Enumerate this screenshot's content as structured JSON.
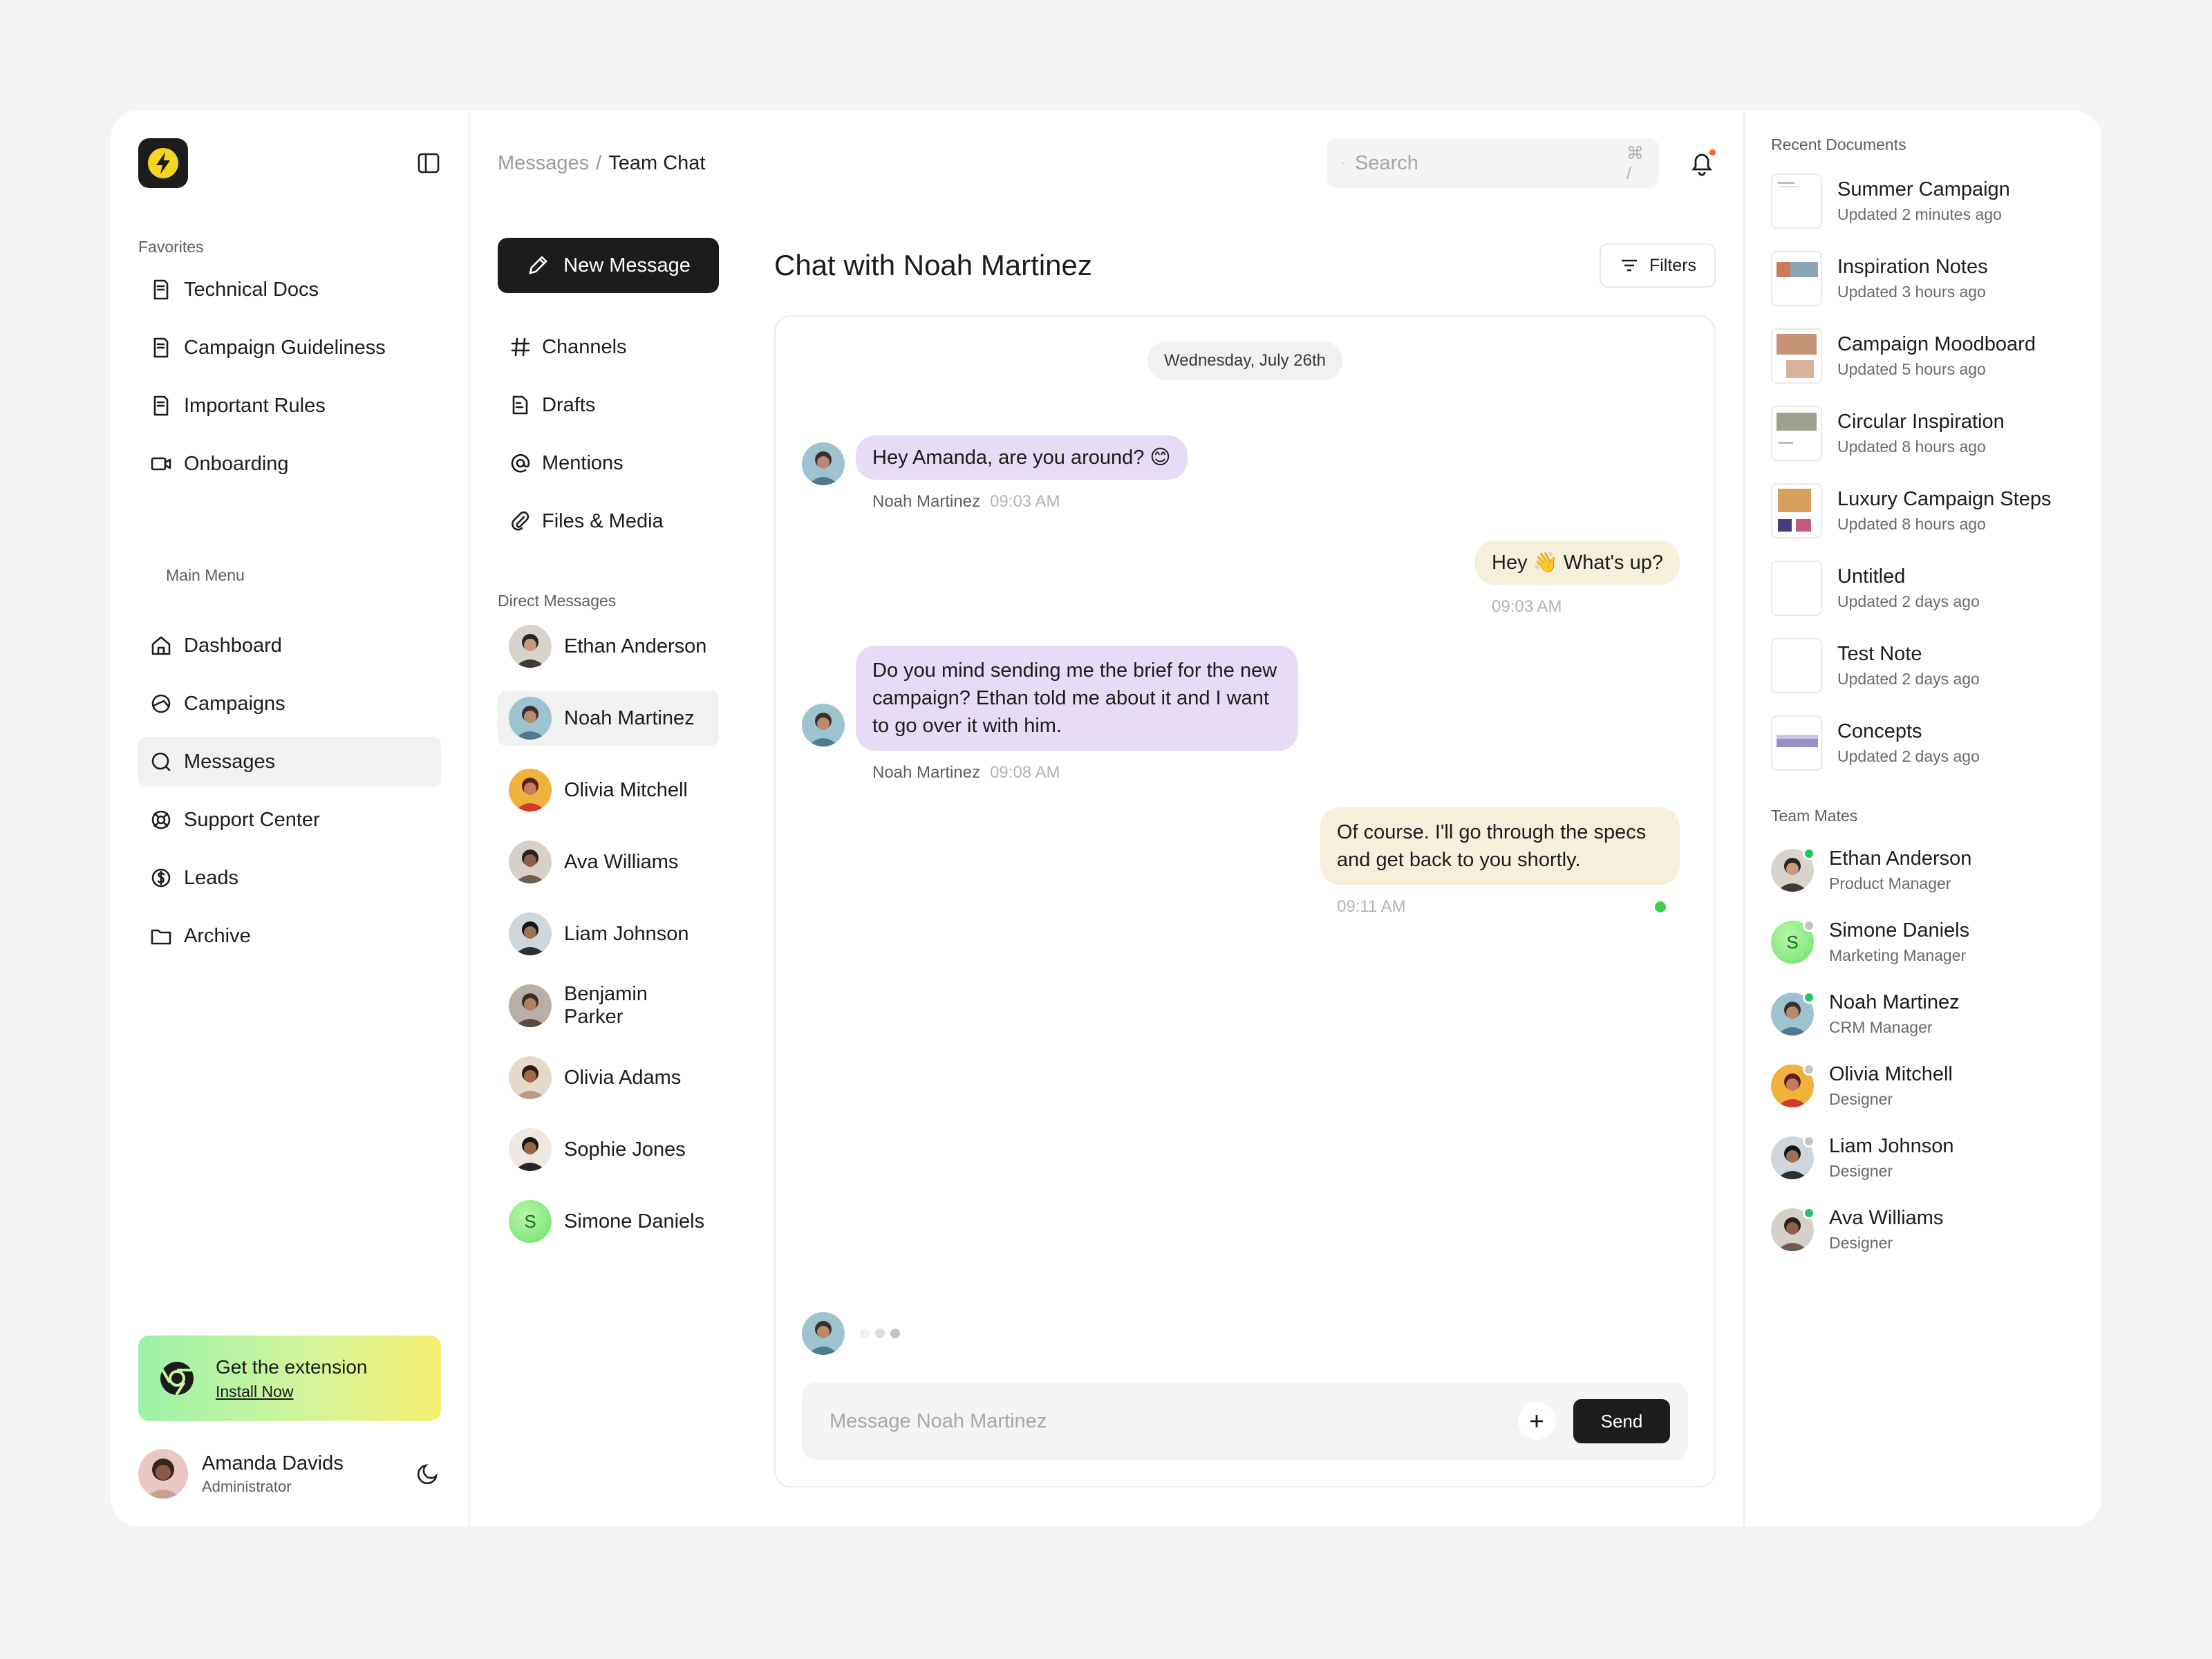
{
  "sidebar": {
    "favorites_label": "Favorites",
    "favorites": [
      {
        "label": "Technical Docs",
        "icon": "document-icon"
      },
      {
        "label": "Campaign Guideliness",
        "icon": "document-icon"
      },
      {
        "label": "Important Rules",
        "icon": "document-icon"
      },
      {
        "label": "Onboarding",
        "icon": "video-icon"
      }
    ],
    "main_menu_label": "Main Menu",
    "main_menu": [
      {
        "label": "Dashboard",
        "icon": "home-icon"
      },
      {
        "label": "Campaigns",
        "icon": "compass-icon"
      },
      {
        "label": "Messages",
        "icon": "message-icon",
        "active": true
      },
      {
        "label": "Support Center",
        "icon": "lifebuoy-icon"
      },
      {
        "label": "Leads",
        "icon": "dollar-icon"
      },
      {
        "label": "Archive",
        "icon": "folder-icon"
      }
    ],
    "extension": {
      "title": "Get the extension",
      "link": "Install Now"
    },
    "profile": {
      "name": "Amanda Davids",
      "role": "Administrator"
    }
  },
  "header": {
    "breadcrumb_parent": "Messages",
    "breadcrumb_sep": "/",
    "breadcrumb_current": "Team Chat",
    "search_placeholder": "Search",
    "search_shortcut": "⌘ /"
  },
  "message_nav": {
    "new_message": "New Message",
    "items": [
      {
        "label": "Channels",
        "icon": "hash-icon"
      },
      {
        "label": "Drafts",
        "icon": "draft-icon"
      },
      {
        "label": "Mentions",
        "icon": "at-icon"
      },
      {
        "label": "Files & Media",
        "icon": "paperclip-icon"
      }
    ],
    "dm_label": "Direct Messages",
    "direct_messages": [
      {
        "name": "Ethan Anderson"
      },
      {
        "name": "Noah Martinez",
        "active": true
      },
      {
        "name": "Olivia Mitchell"
      },
      {
        "name": "Ava Williams"
      },
      {
        "name": "Liam Johnson"
      },
      {
        "name": "Benjamin Parker"
      },
      {
        "name": "Olivia Adams"
      },
      {
        "name": "Sophie Jones"
      },
      {
        "name": "Simone Daniels",
        "initial": "S"
      }
    ]
  },
  "chat": {
    "title": "Chat with Noah Martinez",
    "filters": "Filters",
    "date": "Wednesday, July 26th",
    "messages": [
      {
        "direction": "in",
        "text": "Hey Amanda, are you around? 😊",
        "sender": "Noah Martinez",
        "time": "09:03 AM"
      },
      {
        "direction": "out",
        "text": "Hey 👋 What's up?",
        "time": "09:03 AM"
      },
      {
        "direction": "in",
        "text": "Do you mind sending me the brief for the new campaign? Ethan told me about it and I want to go over it with him.",
        "sender": "Noah Martinez",
        "time": "09:08 AM"
      },
      {
        "direction": "out",
        "text": "Of course. I'll go through the specs and get back to you shortly.",
        "time": "09:11 AM"
      }
    ],
    "composer_placeholder": "Message Noah Martinez",
    "send": "Send"
  },
  "right_panel": {
    "recent_label": "Recent Documents",
    "documents": [
      {
        "title": "Summer Campaign",
        "updated": "Updated 2 minutes ago"
      },
      {
        "title": "Inspiration Notes",
        "updated": "Updated 3 hours ago"
      },
      {
        "title": "Campaign Moodboard",
        "updated": "Updated 5 hours ago"
      },
      {
        "title": "Circular Inspiration",
        "updated": "Updated 8 hours ago"
      },
      {
        "title": "Luxury Campaign Steps",
        "updated": "Updated 8 hours ago"
      },
      {
        "title": "Untitled",
        "updated": "Updated 2 days ago"
      },
      {
        "title": "Test Note",
        "updated": "Updated 2 days ago"
      },
      {
        "title": "Concepts",
        "updated": "Updated 2 days ago"
      }
    ],
    "team_label": "Team Mates",
    "team": [
      {
        "name": "Ethan Anderson",
        "role": "Product Manager",
        "status": "online"
      },
      {
        "name": "Simone Daniels",
        "role": "Marketing Manager",
        "status": "offline",
        "initial": "S"
      },
      {
        "name": "Noah Martinez",
        "role": "CRM Manager",
        "status": "online"
      },
      {
        "name": "Olivia Mitchell",
        "role": "Designer",
        "status": "offline"
      },
      {
        "name": "Liam Johnson",
        "role": "Designer",
        "status": "offline"
      },
      {
        "name": "Ava Williams",
        "role": "Designer",
        "status": "online"
      }
    ]
  },
  "colors": {
    "accent": "#1c1c1c",
    "logo_yellow": "#f4d61e",
    "incoming_bubble": "#e8dbf6",
    "outgoing_bubble": "#f6efdc",
    "online": "#22c55e",
    "offline": "#c4c4c4",
    "notification_dot": "#f5652b"
  }
}
